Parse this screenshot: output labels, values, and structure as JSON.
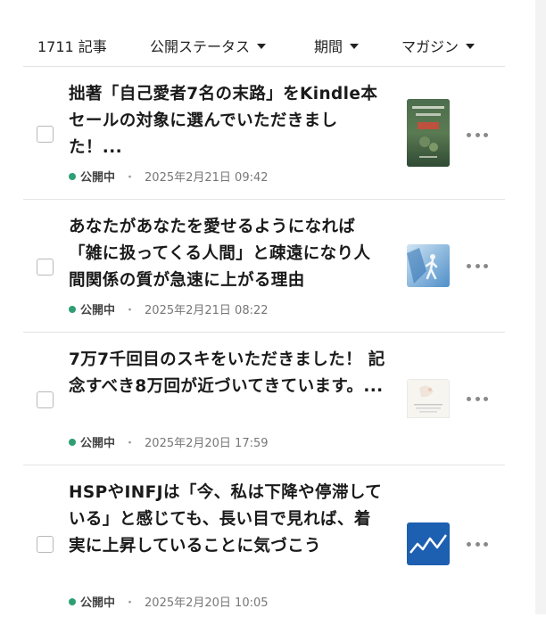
{
  "header": {
    "count": "1711 記事",
    "filters": [
      {
        "label": "公開ステータス"
      },
      {
        "label": "期間"
      },
      {
        "label": "マガジン"
      }
    ]
  },
  "status_color": "#2e9f74",
  "articles": [
    {
      "title": "拙著「自己愛者7名の末路」をKindle本セールの対象に選んでいただきました！...",
      "status": "公開中",
      "date": "2025年2月21日 09:42",
      "thumbnail": "book-cover-icon"
    },
    {
      "title": "あなたがあなたを愛せるようになれば「雑に扱ってくる人間」と疎遠になり人間関係の質が急速に上がる理由",
      "status": "公開中",
      "date": "2025年2月21日 08:22",
      "thumbnail": "walking-person-icon"
    },
    {
      "title": "7万7千回目のスキをいただきました！ 記念すべき8万回が近づいてきています。...",
      "status": "公開中",
      "date": "2025年2月20日 17:59",
      "thumbnail": "screenshot-thumbnail-icon"
    },
    {
      "title": "HSPやINFJは「今、私は下降や停滞している」と感じても、長い目で見れば、着実に上昇していることに気づこう",
      "status": "公開中",
      "date": "2025年2月20日 10:05",
      "thumbnail": "line-chart-icon"
    }
  ],
  "meta_separator": "・"
}
